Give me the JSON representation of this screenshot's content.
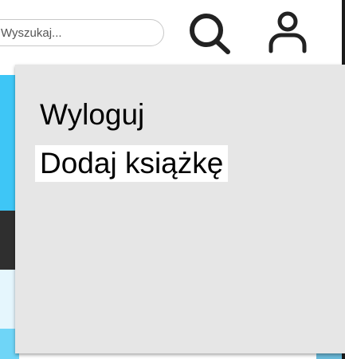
{
  "header": {
    "search": {
      "placeholder": "Wyszukaj...",
      "value": ""
    },
    "search_icon": "search-icon",
    "user_icon": "user-icon"
  },
  "dropdown": {
    "items": [
      {
        "label": "Wyloguj",
        "highlighted": false
      },
      {
        "label": "Dodaj książkę",
        "highlighted": true
      }
    ]
  },
  "colors": {
    "dropdown_bg": "#e6e6e6",
    "highlight_bg": "#ffffff",
    "icon_color": "#222222",
    "accent_cyan": "#3ec6f6"
  }
}
